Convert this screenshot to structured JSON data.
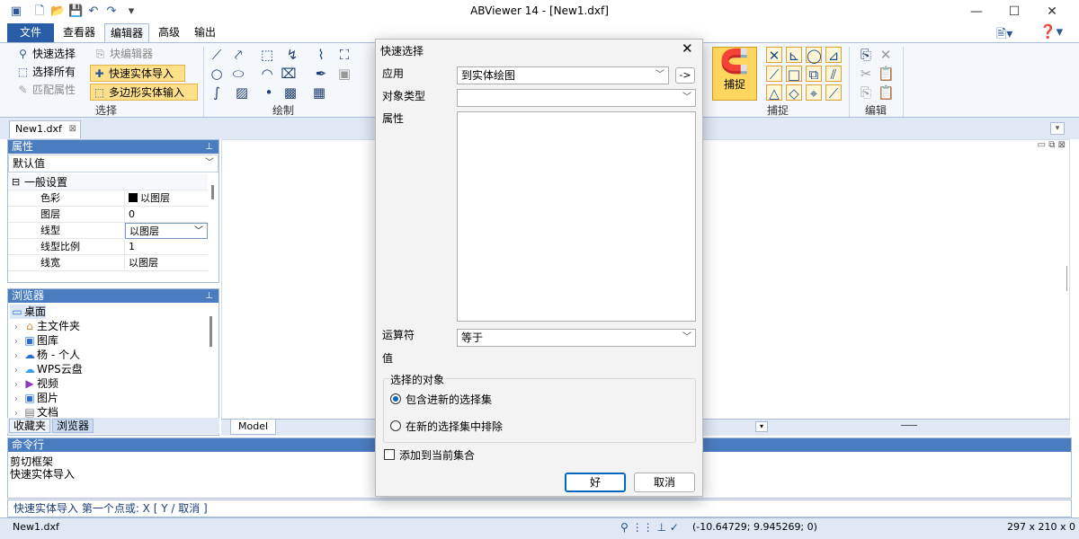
{
  "window": {
    "title": "ABViewer 14 - [New1.dxf]"
  },
  "menu": {
    "file": "文件",
    "viewer": "查看器",
    "editor": "编辑器",
    "advanced": "高级",
    "output": "输出"
  },
  "ribbon": {
    "select": {
      "quick_select": "快速选择",
      "select_all": "选择所有",
      "match_props": "匹配属性",
      "block_editor": "块编辑器",
      "quick_entity_import": "快速实体导入",
      "polygon_entity_input": "多边形实体输入",
      "label": "选择"
    },
    "draw_label": "绘制",
    "snap_button": "捕捉",
    "snap_label": "捕捉",
    "edit_label": "编辑"
  },
  "doc_tab": "New1.dxf",
  "properties": {
    "header": "属性",
    "preset": "默认值",
    "section": "一般设置",
    "rows": [
      {
        "key": "色彩",
        "value": "以图层"
      },
      {
        "key": "图层",
        "value": "0"
      },
      {
        "key": "线型",
        "value": "以图层"
      },
      {
        "key": "线型比例",
        "value": "1"
      },
      {
        "key": "线宽",
        "value": "以图层"
      }
    ]
  },
  "browser": {
    "header": "浏览器",
    "items": [
      "桌面",
      "主文件夹",
      "图库",
      "杨 - 个人",
      "WPS云盘",
      "视频",
      "图片",
      "文档"
    ]
  },
  "bottom_tabs": {
    "favorites": "收藏夹",
    "browser": "浏览器"
  },
  "model_tab": "Model",
  "command": {
    "header": "命令行",
    "history": [
      "剪切框架",
      "快速实体导入"
    ],
    "prompt": "快速实体导入  第一个点或: X [ Y / 取消 ]"
  },
  "status": {
    "file": "New1.dxf",
    "coords": "(-10.64729; 9.945269; 0)",
    "size": "297 x 210 x 0"
  },
  "dialog": {
    "title": "快速选择",
    "apply_label": "应用",
    "apply_value": "到实体绘图",
    "apply_button": "->",
    "object_type_label": "对象类型",
    "object_type_value": "",
    "props_label": "属性",
    "operator_label": "运算符",
    "operator_value": "等于",
    "value_label": "值",
    "selected_group": "选择的对象",
    "include_option": "包含进新的选择集",
    "exclude_option": "在新的选择集中排除",
    "append_label": "添加到当前集合",
    "ok": "好",
    "cancel": "取消"
  }
}
